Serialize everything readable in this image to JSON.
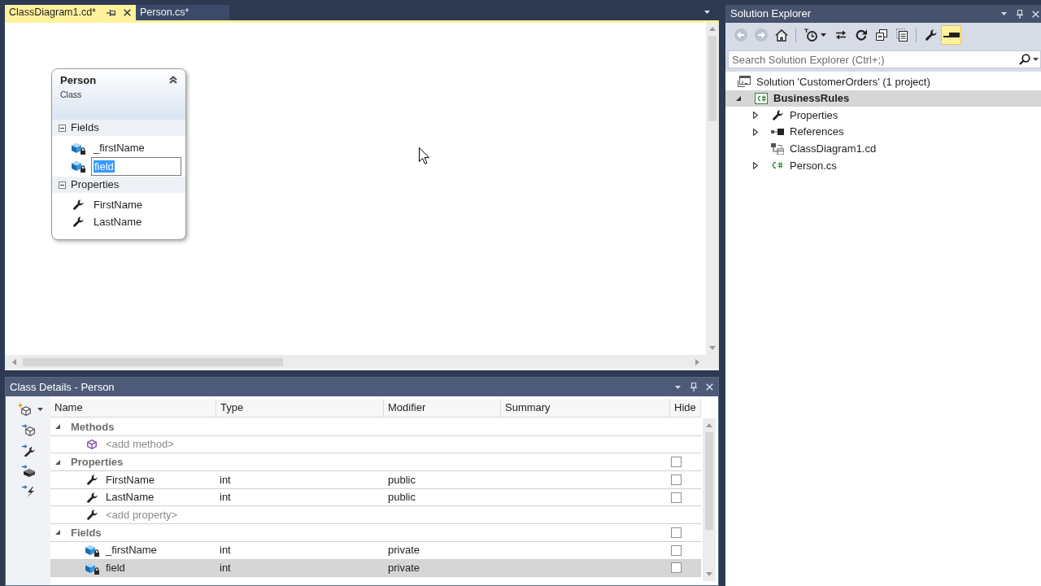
{
  "editor": {
    "tabs": [
      {
        "label": "ClassDiagram1.cd*",
        "selected": true
      },
      {
        "label": "Person.cs*",
        "selected": false
      }
    ],
    "class_shape": {
      "name": "Person",
      "subtitle": "Class",
      "sections": [
        {
          "label": "Fields",
          "kind": "fields",
          "expanded": true,
          "members": [
            {
              "name": "_firstName",
              "editing": false
            },
            {
              "name": "field",
              "editing": true
            }
          ]
        },
        {
          "label": "Properties",
          "kind": "properties",
          "expanded": true,
          "members": [
            {
              "name": "FirstName",
              "editing": false
            },
            {
              "name": "LastName",
              "editing": false
            }
          ]
        }
      ]
    }
  },
  "class_details": {
    "title": "Class Details - Person",
    "columns": [
      "Name",
      "Type",
      "Modifier",
      "Summary",
      "Hide"
    ],
    "groups": [
      {
        "label": "Methods",
        "kind": "methods",
        "expanded": true,
        "rows": [
          {
            "placeholder": "<add method>",
            "selected": false
          }
        ]
      },
      {
        "label": "Properties",
        "kind": "properties",
        "expanded": true,
        "hidden": false,
        "rows": [
          {
            "name": "FirstName",
            "type": "int",
            "modifier": "public",
            "hidden": false,
            "selected": false
          },
          {
            "name": "LastName",
            "type": "int",
            "modifier": "public",
            "hidden": false,
            "selected": false
          },
          {
            "placeholder": "<add property>",
            "selected": false
          }
        ]
      },
      {
        "label": "Fields",
        "kind": "fields",
        "expanded": true,
        "hidden": false,
        "rows": [
          {
            "name": "_firstName",
            "type": "int",
            "modifier": "private",
            "hidden": false,
            "selected": false
          },
          {
            "name": "field",
            "type": "int",
            "modifier": "private",
            "hidden": false,
            "selected": true
          }
        ]
      }
    ]
  },
  "solution_explorer": {
    "title": "Solution Explorer",
    "toolbar": [
      {
        "kind": "back",
        "disabled": true,
        "on": false
      },
      {
        "kind": "forward",
        "disabled": true,
        "on": false
      },
      {
        "kind": "home",
        "disabled": false,
        "on": false
      },
      {
        "kind": "separator"
      },
      {
        "kind": "pending_changes_filter",
        "disabled": false,
        "on": false
      },
      {
        "kind": "sync",
        "disabled": false,
        "on": false
      },
      {
        "kind": "refresh",
        "disabled": false,
        "on": false
      },
      {
        "kind": "collapse_all",
        "disabled": false,
        "on": false
      },
      {
        "kind": "show_all_files",
        "disabled": false,
        "on": false
      },
      {
        "kind": "separator"
      },
      {
        "kind": "properties",
        "disabled": false,
        "on": false
      },
      {
        "kind": "preview",
        "disabled": false,
        "on": true
      }
    ],
    "search": {
      "placeholder": "Search Solution Explorer (Ctrl+;)"
    },
    "tree": [
      {
        "label": "Solution 'CustomerOrders' (1 project)",
        "kind": "solution",
        "selected": false,
        "children": [
          {
            "label": "BusinessRules",
            "kind": "csharp_project",
            "expanded": true,
            "selected": true,
            "children": [
              {
                "label": "Properties",
                "kind": "properties",
                "expanded": false,
                "selected": false
              },
              {
                "label": "References",
                "kind": "references",
                "expanded": false,
                "selected": false
              },
              {
                "label": "ClassDiagram1.cd",
                "kind": "class_diagram",
                "selected": false
              },
              {
                "label": "Person.cs",
                "kind": "csharp_file",
                "expanded": false,
                "selected": false
              }
            ]
          }
        ]
      }
    ]
  }
}
